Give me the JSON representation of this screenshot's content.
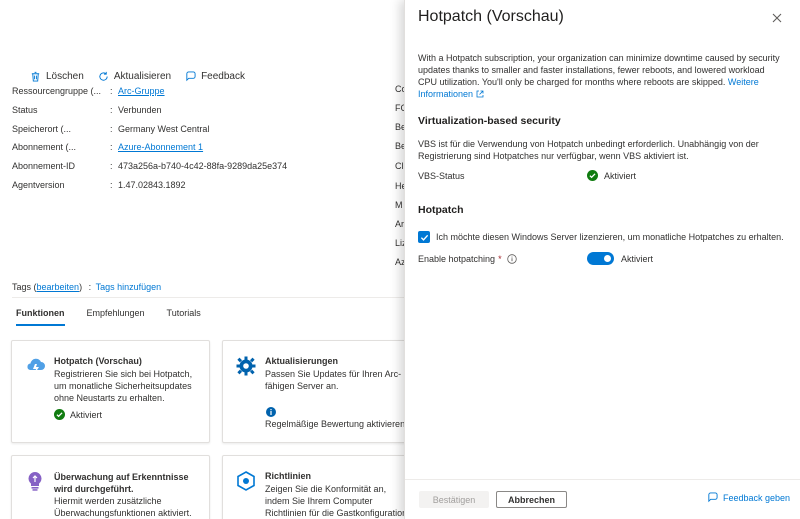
{
  "toolbar": {
    "delete_label": "Löschen",
    "refresh_label": "Aktualisieren",
    "feedback_label": "Feedback"
  },
  "properties": [
    {
      "key": "Ressourcengruppe (...",
      "value": "Arc-Gruppe",
      "link": true
    },
    {
      "key": "Status",
      "value": "Verbunden",
      "link": false
    },
    {
      "key": "Speicherort (...",
      "value": "Germany West Central",
      "link": false
    },
    {
      "key": "Abonnement (...",
      "value": "Azure-Abonnement 1",
      "link": true
    },
    {
      "key": "Abonnement-ID",
      "value": "473a256a-b740-4c42-88fa-9289da25e374",
      "link": false
    },
    {
      "key": "Agentversion",
      "value": "1.47.02843.1892",
      "link": false
    }
  ],
  "right_keys": [
    "Co",
    "FC",
    "Be",
    "Be",
    "Cl",
    "He",
    "M",
    "Ar",
    "Liz",
    "Az"
  ],
  "tags": {
    "label": "Tags (",
    "edit_link": "bearbeiten",
    "close": ")",
    "colon": ":",
    "add_link": "Tags hinzufügen"
  },
  "tabs": [
    "Funktionen",
    "Empfehlungen",
    "Tutorials"
  ],
  "cards": {
    "hotpatch": {
      "title": "Hotpatch (Vorschau)",
      "desc": "Registrieren Sie sich bei Hotpatch, um monatliche Sicherheitsupdates ohne Neustarts zu erhalten.",
      "status": "Aktiviert"
    },
    "updates": {
      "title": "Aktualisierungen",
      "desc": "Passen Sie Updates für Ihren Arc-fähigen Server an.",
      "link": "Regelmäßige Bewertung aktivieren"
    },
    "monitoring": {
      "title": "Überwachung auf Erkenntnisse wird durchgeführt.",
      "desc": "Hiermit werden zusätzliche Überwachungsfunktionen aktiviert."
    },
    "policies": {
      "title": "Richtlinien",
      "desc": "Zeigen Sie die Konformität an, indem Sie Ihrem Computer Richtlinien für die Gastkonfiguration"
    }
  },
  "panel": {
    "title": "Hotpatch (Vorschau)",
    "intro": "With a Hotpatch subscription, your organization can minimize downtime caused by security updates thanks to smaller and faster installations, fewer reboots, and lowered workload CPU utilization. You'll only be charged for months where reboots are skipped.",
    "intro_link": "Weitere Informationen",
    "vbs_heading": "Virtualization-based security",
    "vbs_text": "VBS ist für die Verwendung von Hotpatch unbedingt erforderlich. Unabhängig von der Registrierung sind Hotpatches nur verfügbar, wenn VBS aktiviert ist.",
    "vbs_status_label": "VBS-Status",
    "vbs_status_value": "Aktiviert",
    "hotpatch_heading": "Hotpatch",
    "license_checkbox": "Ich möchte diesen Windows Server lizenzieren, um monatliche Hotpatches zu erhalten.",
    "enable_label": "Enable hotpatching",
    "required_mark": "*",
    "enable_value": "Aktiviert",
    "confirm_button": "Bestätigen",
    "cancel_button": "Abbrechen",
    "feedback_link": "Feedback geben"
  },
  "colors": {
    "accent": "#0078d4",
    "success": "#107c10",
    "disabled_text": "#a19f9d"
  }
}
